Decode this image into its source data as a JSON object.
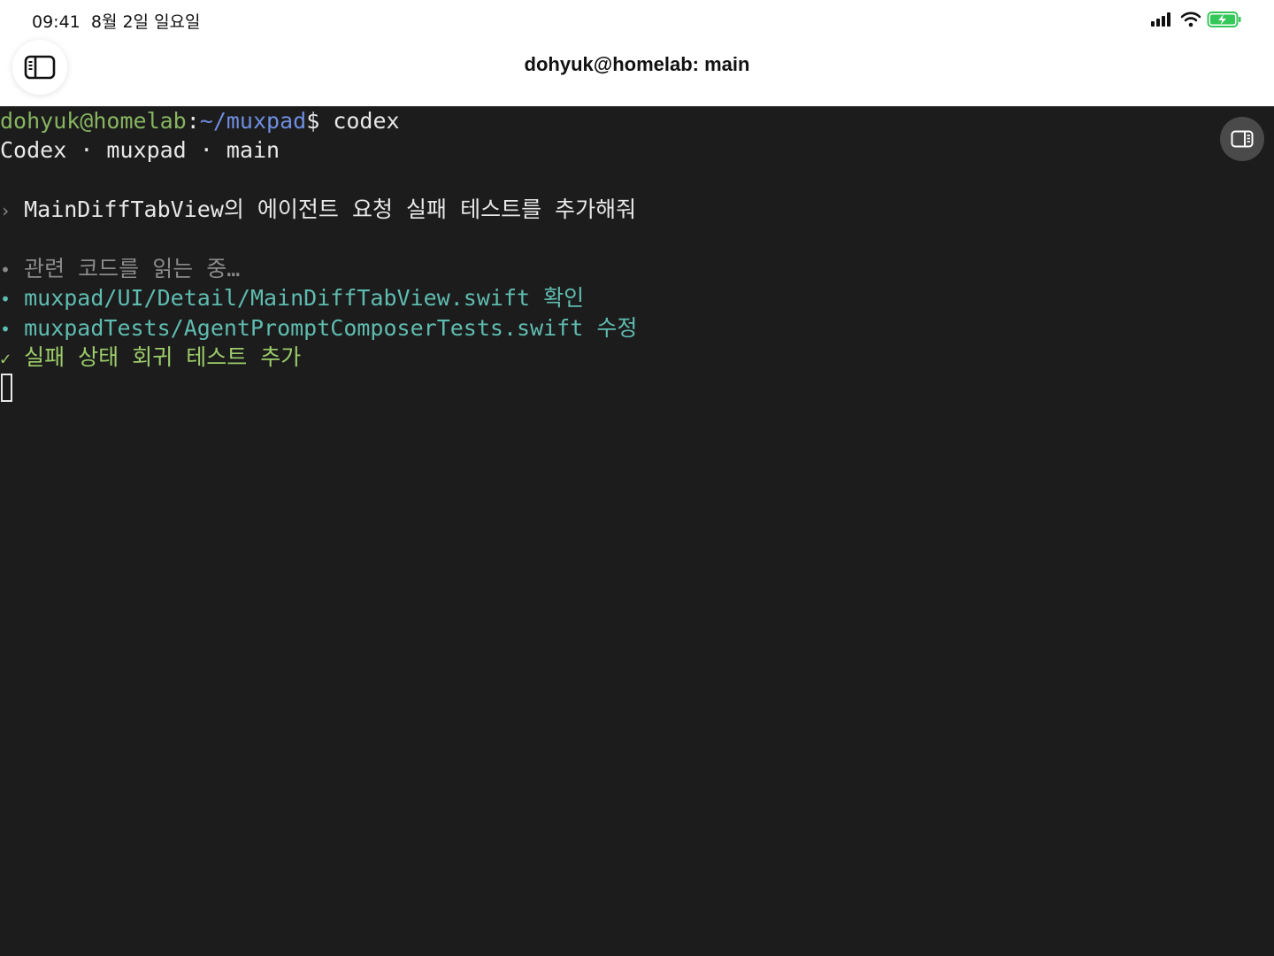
{
  "status_bar": {
    "time": "09:41",
    "date": "8월 2일 일요일",
    "icons": [
      "cellular-signal-icon",
      "wifi-icon",
      "battery-charging-icon"
    ],
    "battery_color": "#34c759"
  },
  "header": {
    "title": "dohyuk@homelab: main",
    "left_button_icon": "sidebar-icon",
    "right_button_icon": "panel-toggle-icon"
  },
  "terminal": {
    "prompt": {
      "user_host": "dohyuk@homelab",
      "separator": ":",
      "path": "~/muxpad",
      "symbol": "$",
      "command": " codex"
    },
    "header_line": {
      "app": "Codex",
      "sep1": " · ",
      "repo": "muxpad",
      "sep2": " · ",
      "branch": "main"
    },
    "user_message": {
      "marker": "›",
      "text": " MainDiffTabView의 에이전트 요청 실패 테스트를 추가해줘"
    },
    "activity": [
      {
        "marker": "•",
        "text": " 관련 코드를 읽는 중…"
      },
      {
        "marker": "•",
        "file": " muxpad/UI/Detail/MainDiffTabView.swift",
        "action": " 확인"
      },
      {
        "marker": "•",
        "file": " muxpadTests/AgentPromptComposerTests.swift",
        "action": " 수정"
      },
      {
        "marker": "✓",
        "text": " 실패 상태 회귀 테스트 추가"
      }
    ],
    "colors": {
      "background": "#1c1c1c",
      "text": "#e8e8e8",
      "user_host": "#87b560",
      "path": "#6f8ee0",
      "dim": "#8a8a8a",
      "file": "#5fbcb0",
      "success": "#9ccc6a"
    }
  }
}
